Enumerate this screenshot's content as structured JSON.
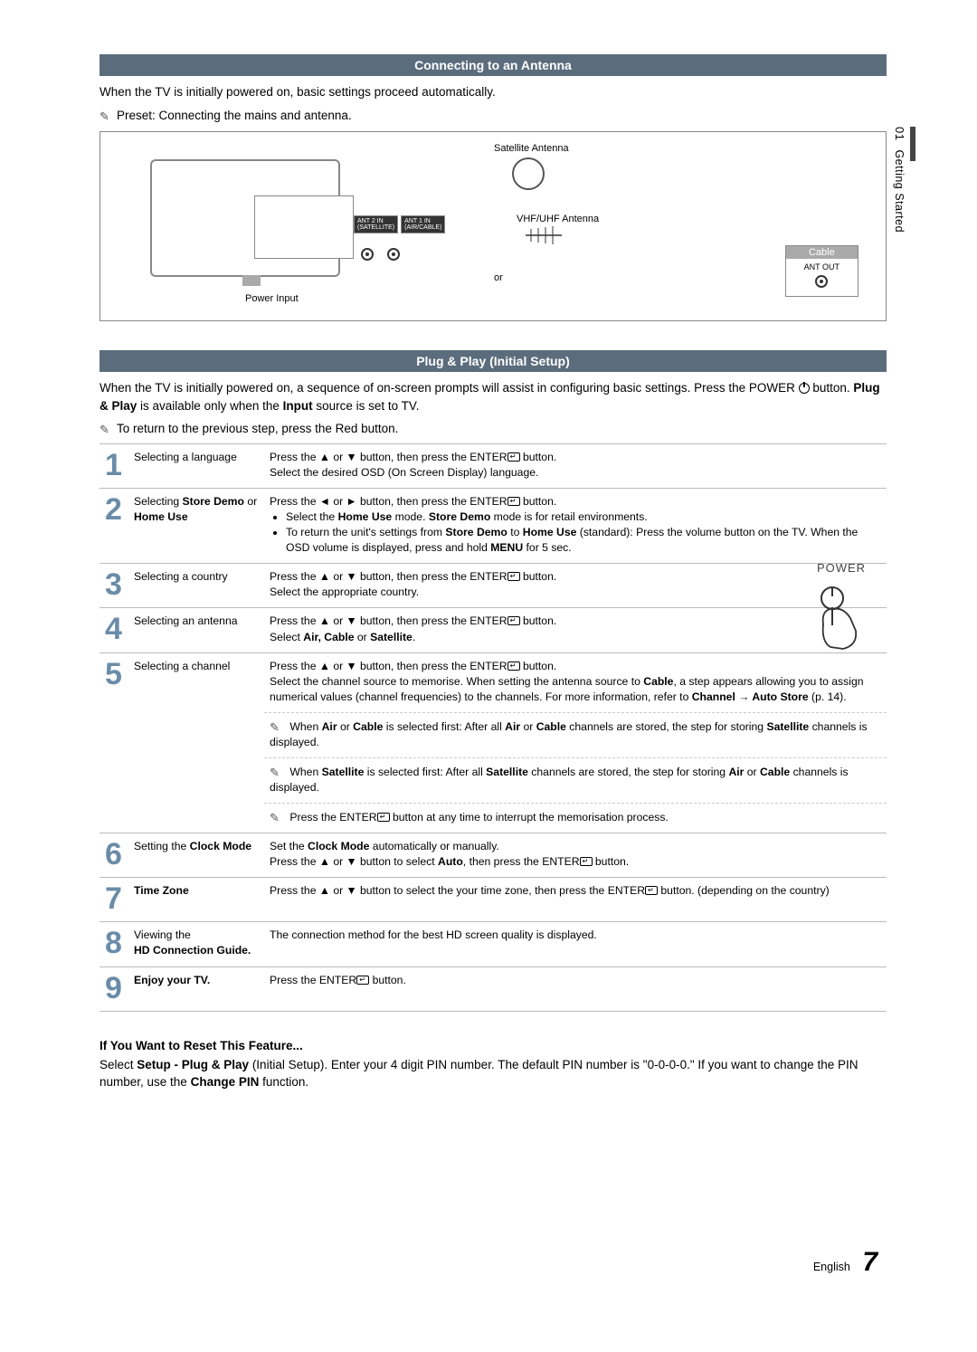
{
  "sidebar": {
    "chapter_num": "01",
    "chapter_title": "Getting Started"
  },
  "section1": {
    "title": "Connecting to an Antenna",
    "intro": "When the TV is initially powered on, basic settings proceed automatically.",
    "preset_note": "Preset: Connecting the mains and antenna.",
    "diagram": {
      "satellite": "Satellite Antenna",
      "vhf": "VHF/UHF Antenna",
      "ant2": "ANT 2 IN\n(SATELLITE)",
      "ant1": "ANT 1 IN\n(AIR/CABLE)",
      "or": "or",
      "power_input": "Power Input",
      "cable_title": "Cable",
      "ant_out": "ANT OUT"
    }
  },
  "section2": {
    "title": "Plug & Play (Initial Setup)",
    "intro_a": "When the TV is initially powered on, a sequence of on-screen prompts will assist in configuring basic settings. Press the POWER ",
    "intro_b": " button. ",
    "intro_bold1": "Plug & Play",
    "intro_c": " is available only when the ",
    "intro_bold2": "Input",
    "intro_d": " source is set to TV.",
    "return_note": "To return to the previous step, press the Red button.",
    "power_label": "POWER"
  },
  "steps": [
    {
      "n": "1",
      "label": "Selecting a language",
      "desc_a": "Press the ▲ or ▼ button, then press the ENTER",
      "desc_b": " button.",
      "desc_c": "Select the desired OSD (On Screen Display) language."
    },
    {
      "n": "2",
      "label_a": "Selecting ",
      "label_b": "Store Demo",
      "label_c": " or ",
      "label_d": "Home Use",
      "desc_a": "Press the ◄ or ► button, then press the ENTER",
      "desc_b": " button.",
      "bullets": [
        {
          "a": "Select the ",
          "b": "Home Use",
          "c": " mode. ",
          "d": "Store Demo",
          "e": " mode is for retail environments."
        },
        {
          "a": "To return the unit's settings from ",
          "b": "Store Demo",
          "c": " to ",
          "d": "Home Use",
          "e": " (standard): Press the volume button on the TV. When the OSD volume is displayed, press and hold ",
          "f": "MENU",
          "g": " for 5 sec."
        }
      ]
    },
    {
      "n": "3",
      "label": "Selecting a country",
      "desc_a": "Press the ▲ or ▼ button, then press the ENTER",
      "desc_b": " button.",
      "desc_c": "Select the appropriate country."
    },
    {
      "n": "4",
      "label": "Selecting an antenna",
      "desc_a": "Press the ▲ or ▼ button, then press the ENTER",
      "desc_b": " button.",
      "desc_c": "Select ",
      "desc_bold": "Air, Cable",
      "desc_d": " or ",
      "desc_bold2": "Satellite",
      "desc_e": "."
    },
    {
      "n": "5",
      "label": "Selecting a channel",
      "desc_a": "Press the ▲ or ▼ button, then press the ENTER",
      "desc_b": " button.",
      "desc_long_a": "Select the channel source to memorise. When setting the antenna source to ",
      "desc_long_b": "Cable",
      "desc_long_c": ", a step appears allowing you to assign numerical values (channel frequencies) to the channels. For more information, refer to ",
      "desc_long_d": "Channel → Auto Store",
      "desc_long_e": " (p. 14).",
      "note1_a": "When ",
      "note1_b": "Air",
      "note1_c": " or ",
      "note1_d": "Cable",
      "note1_e": " is selected first: After all ",
      "note1_f": "Air",
      "note1_g": " or ",
      "note1_h": "Cable",
      "note1_i": " channels are stored, the step for storing ",
      "note1_j": "Satellite",
      "note1_k": " channels is displayed.",
      "note2_a": "When ",
      "note2_b": "Satellite",
      "note2_c": " is selected first: After all ",
      "note2_d": "Satellite",
      "note2_e": " channels are stored, the step for storing ",
      "note2_f": "Air",
      "note2_g": " or ",
      "note2_h": "Cable",
      "note2_i": " channels is displayed.",
      "note3_a": "Press the ENTER",
      "note3_b": " button at any time to interrupt the memorisation process."
    },
    {
      "n": "6",
      "label_a": "Setting the ",
      "label_b": "Clock Mode",
      "desc_a": "Set the ",
      "desc_b": "Clock Mode",
      "desc_c": " automatically or manually.",
      "desc_d": "Press the ▲ or ▼ button to select ",
      "desc_e": "Auto",
      "desc_f": ", then press the ENTER",
      "desc_g": " button."
    },
    {
      "n": "7",
      "label": "Time Zone",
      "desc_a": "Press the ▲ or ▼ button to select the your time zone, then press the ENTER",
      "desc_b": " button. (depending on the country)"
    },
    {
      "n": "8",
      "label_a": "Viewing the ",
      "label_b": "HD Connection Guide.",
      "desc": "The connection method for the best HD screen quality is displayed."
    },
    {
      "n": "9",
      "label": "Enjoy your TV.",
      "desc_a": "Press the ENTER",
      "desc_b": " button."
    }
  ],
  "reset": {
    "heading": "If You Want to Reset This Feature...",
    "body_a": "Select ",
    "body_b": "Setup - Plug & Play",
    "body_c": " (Initial Setup). Enter your 4 digit PIN number. The default PIN number is \"0-0-0-0.\" If you want to change the PIN number, use the ",
    "body_d": "Change PIN",
    "body_e": " function."
  },
  "footer": {
    "lang": "English",
    "page": "7"
  }
}
